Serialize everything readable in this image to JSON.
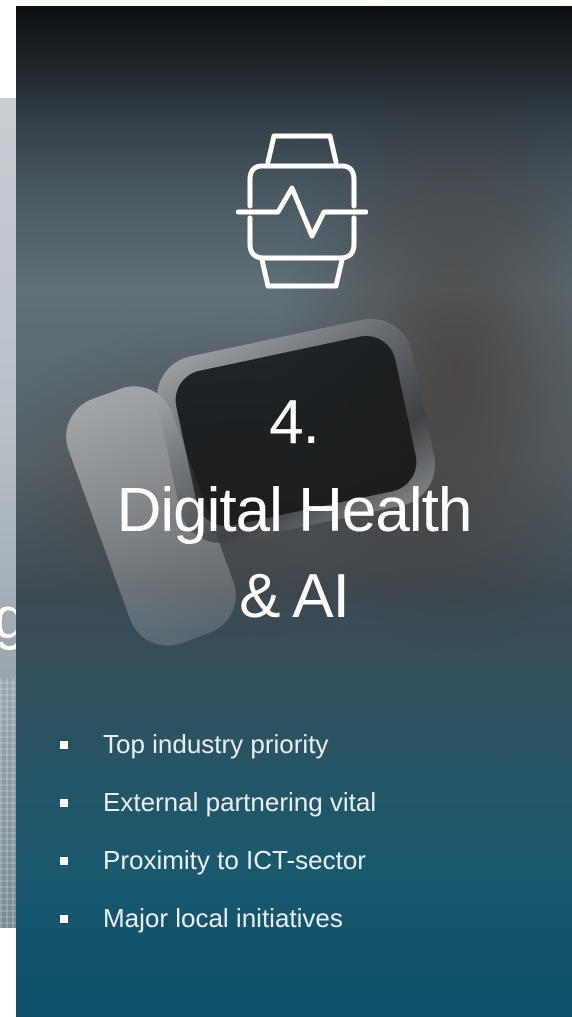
{
  "slide": {
    "number": "4.",
    "title_line1": "Digital Health",
    "title_line2": "& AI",
    "icon": "smartwatch-heartbeat-icon",
    "bullets": [
      "Top industry priority",
      "External partnering vital",
      "Proximity to ICT-sector",
      "Major local initiatives"
    ]
  },
  "side_card": {
    "visible_glyph": "g"
  },
  "colors": {
    "text": "#ffffff",
    "bottom_tint": "#12566e"
  }
}
